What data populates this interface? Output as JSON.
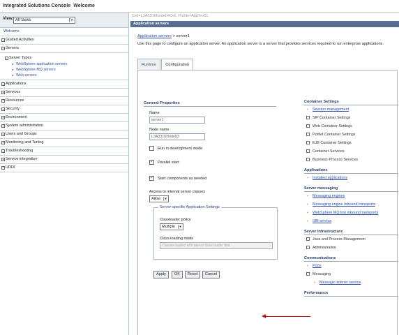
{
  "app": {
    "title": "Integrated Solutions Console",
    "subtitle": "Welcome"
  },
  "left": {
    "view_label": "View:",
    "view_value": "All tasks",
    "welcome": "Welcome",
    "items_before": [
      "Guided Activities",
      "Servers"
    ],
    "server_types": "Server Types",
    "server_links": [
      "WebSphere application servers",
      "WebSphere MQ servers",
      "Web servers"
    ],
    "items_after": [
      "Applications",
      "Services",
      "Resources",
      "Security",
      "Environment",
      "System administration",
      "Users and Groups",
      "Monitoring and Tuning",
      "Troubleshooting",
      "Service integration",
      "UDDI"
    ]
  },
  "right": {
    "cell_path": "Cell=L3A3316Node04Cell, Profile=AppSrv01",
    "header": "Application servers",
    "breadcrumb_link": "Application servers",
    "breadcrumb_rest": " > server1",
    "description": "Use this page to configure an application server. An application server is a server that provides services required to run enterprise applications.",
    "tabs": [
      "Runtime",
      "Configuration"
    ],
    "general_title": "General Properties",
    "name_label": "Name",
    "name_value": "server1",
    "node_label": "Node name",
    "node_value": "L3A3316Node03",
    "cb_dev": "Run in development mode",
    "cb_parallel": "Parallel start",
    "cb_components": "Start components as needed",
    "access_label": "Access to internal server classes",
    "access_value": "Allow",
    "ssas_legend": "Server-specific Application Settings",
    "classloader_label": "Classloader policy",
    "classloader_value": "Multiple",
    "class_mode_label": "Class loading mode",
    "class_mode_value": "Classes loaded with parent class loader first",
    "buttons": [
      "Apply",
      "OK",
      "Reset",
      "Cancel"
    ]
  },
  "side": {
    "container_title": "Container Settings",
    "container_items": [
      "Session management",
      "SIP Container Settings",
      "Web Container Settings",
      "Portlet Container Settings",
      "EJB Container Settings",
      "Container Services",
      "Business Process Services"
    ],
    "applications_title": "Applications",
    "applications_items": [
      "Installed applications"
    ],
    "messaging_title": "Server messaging",
    "messaging_items": [
      "Messaging engines",
      "Messaging engine inbound transports",
      "WebSphere MQ link inbound transports",
      "SIB service"
    ],
    "infra_title": "Server Infrastructure",
    "infra_items": [
      "Java and Process Management",
      "Administration"
    ],
    "comm_title": "Communications",
    "comm_items": [
      "Ports",
      "Messaging",
      "Message listener service"
    ],
    "perf_title": "Performance"
  },
  "colors": {
    "header_bg": "#546f91",
    "link": "#2f4ea6",
    "arrow": "#cc1111"
  }
}
